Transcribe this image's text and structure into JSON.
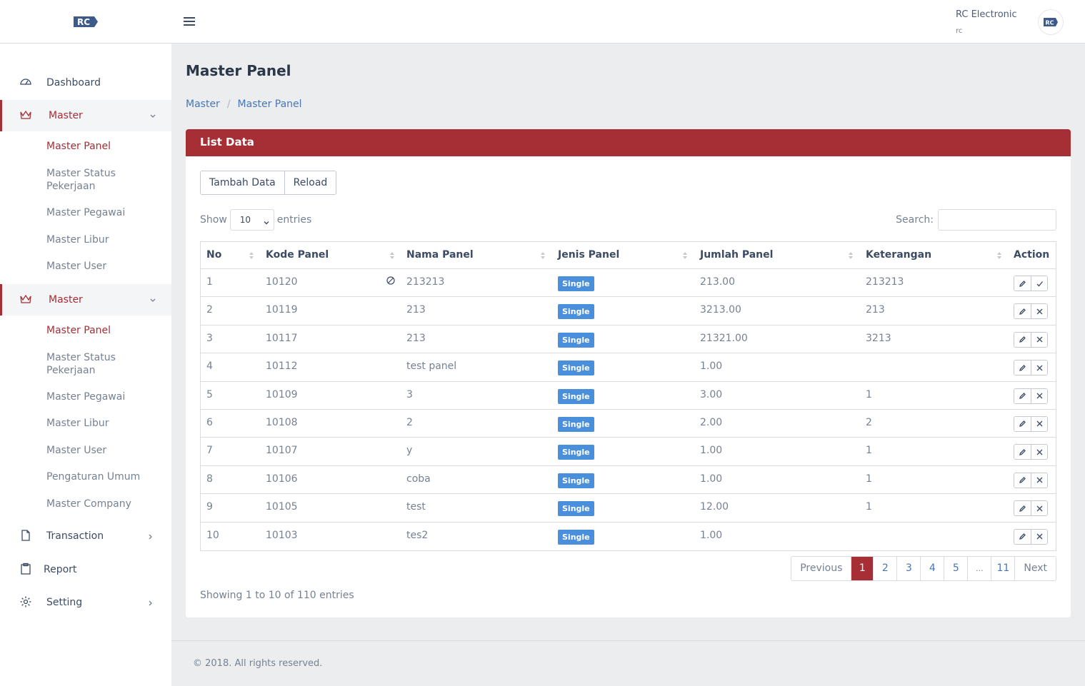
{
  "header": {
    "brand": "RC",
    "user_name": "RC Electronic",
    "user_role": "rc",
    "avatar_text": "RC"
  },
  "sidebar": {
    "items": [
      {
        "label": "Dashboard",
        "icon": "speedometer-icon"
      },
      {
        "label": "Master",
        "icon": "crown-icon"
      },
      {
        "label": "Master",
        "icon": "crown-icon"
      },
      {
        "label": "Transaction",
        "icon": "file-icon"
      },
      {
        "label": "Report",
        "icon": "clipboard-icon"
      },
      {
        "label": "Setting",
        "icon": "gear-icon"
      }
    ],
    "submenu_1": [
      "Master Panel",
      "Master Status Pekerjaan",
      "Master Pegawai",
      "Master Libur",
      "Master User"
    ],
    "submenu_2": [
      "Master Panel",
      "Master Status Pekerjaan",
      "Master Pegawai",
      "Master Libur",
      "Master User",
      "Pengaturan Umum",
      "Master Company"
    ]
  },
  "page": {
    "title": "Master Panel",
    "breadcrumb": [
      "Master",
      "Master Panel"
    ]
  },
  "card": {
    "title": "List Data",
    "buttons": [
      "Tambah Data",
      "Reload"
    ],
    "show_label": "Show",
    "entries_value": "10",
    "entries_label": "entries",
    "search_label": "Search:"
  },
  "table": {
    "columns": [
      "No",
      "Kode Panel",
      "Nama Panel",
      "Jenis Panel",
      "Jumlah Panel",
      "Keterangan",
      "Action"
    ],
    "rows": [
      {
        "no": "1",
        "kode": "10120",
        "nama": "213213",
        "jenis": "Single",
        "jumlah": "213.00",
        "ket": "213213",
        "second_action": "check"
      },
      {
        "no": "2",
        "kode": "10119",
        "nama": "213",
        "jenis": "Single",
        "jumlah": "3213.00",
        "ket": "213",
        "second_action": "x"
      },
      {
        "no": "3",
        "kode": "10117",
        "nama": "213",
        "jenis": "Single",
        "jumlah": "21321.00",
        "ket": "3213",
        "second_action": "x"
      },
      {
        "no": "4",
        "kode": "10112",
        "nama": "test panel",
        "jenis": "Single",
        "jumlah": "1.00",
        "ket": "",
        "second_action": "x"
      },
      {
        "no": "5",
        "kode": "10109",
        "nama": "3",
        "jenis": "Single",
        "jumlah": "3.00",
        "ket": "1",
        "second_action": "x"
      },
      {
        "no": "6",
        "kode": "10108",
        "nama": "2",
        "jenis": "Single",
        "jumlah": "2.00",
        "ket": "2",
        "second_action": "x"
      },
      {
        "no": "7",
        "kode": "10107",
        "nama": "y",
        "jenis": "Single",
        "jumlah": "1.00",
        "ket": "1",
        "second_action": "x"
      },
      {
        "no": "8",
        "kode": "10106",
        "nama": "coba",
        "jenis": "Single",
        "jumlah": "1.00",
        "ket": "1",
        "second_action": "x"
      },
      {
        "no": "9",
        "kode": "10105",
        "nama": "test",
        "jenis": "Single",
        "jumlah": "12.00",
        "ket": "1",
        "second_action": "x"
      },
      {
        "no": "10",
        "kode": "10103",
        "nama": "tes2",
        "jenis": "Single",
        "jumlah": "1.00",
        "ket": "",
        "second_action": "x"
      }
    ]
  },
  "pagination": {
    "previous": "Previous",
    "pages": [
      "1",
      "2",
      "3",
      "4",
      "5",
      "...",
      "11"
    ],
    "next": "Next",
    "current": "1"
  },
  "info": "Showing 1 to 10 of 110 entries",
  "footer": "© 2018. All rights reserved.",
  "colors": {
    "accent": "#a62f36",
    "badge": "#4a8fdc",
    "link": "#4a75b5"
  }
}
